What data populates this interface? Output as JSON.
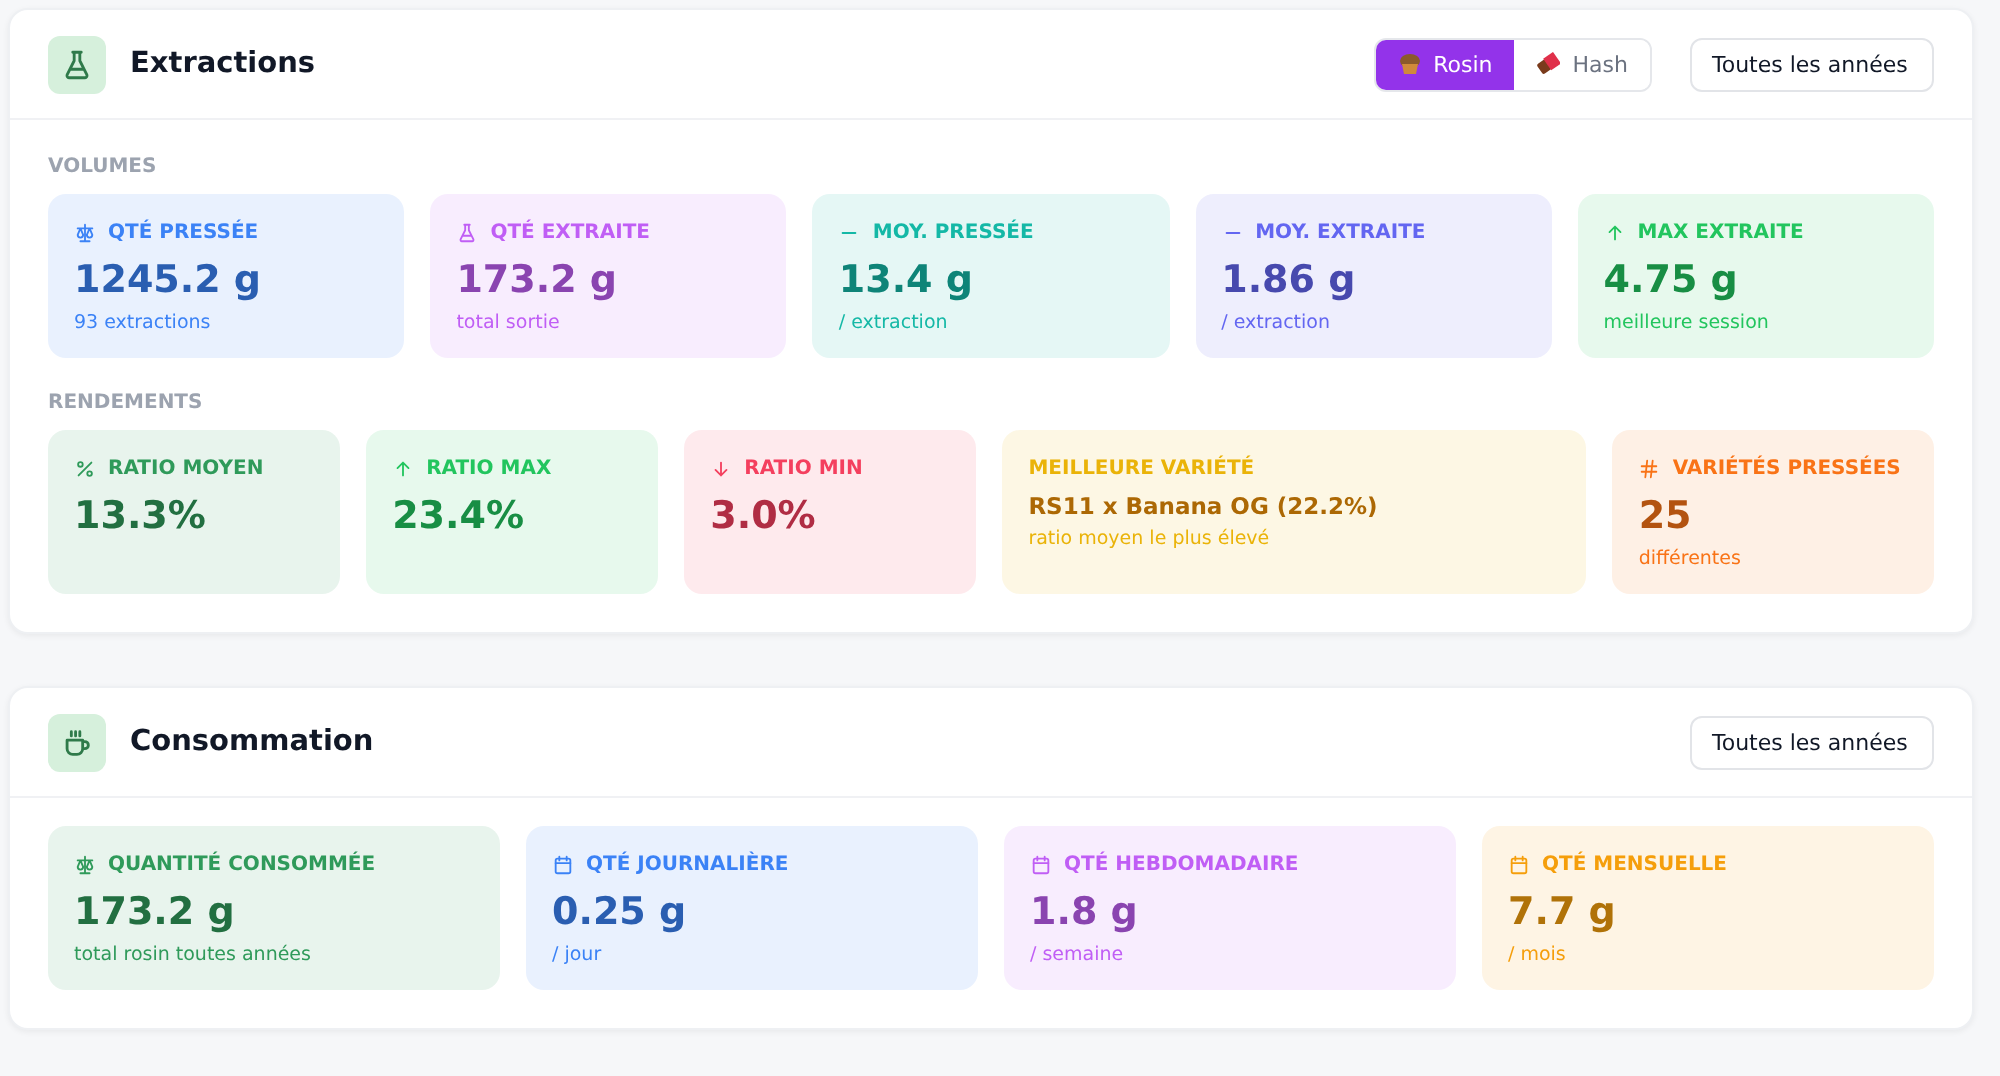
{
  "sections": [
    {
      "title": "Extractions",
      "toggle": [
        {
          "label": "Rosin",
          "selected": true
        },
        {
          "label": "Hash",
          "selected": false
        }
      ],
      "select": {
        "value": "Toutes les années"
      },
      "groups": [
        {
          "heading": "VOLUMES",
          "cards": [
            {
              "kind": "stat",
              "color": "#3b82f6",
              "label": "QTÉ PRESSÉE",
              "value": "1245.2 g",
              "sub": "93 extractions"
            },
            {
              "kind": "stat",
              "color": "#c05ef5",
              "label": "QTÉ EXTRAITE",
              "value": "173.2 g",
              "sub": "total sortie"
            },
            {
              "kind": "stat",
              "color": "#14b8a6",
              "label": "MOY. PRESSÉE",
              "value": "13.4 g",
              "sub": "/ extraction"
            },
            {
              "kind": "stat",
              "color": "#6366f1",
              "label": "MOY. EXTRAITE",
              "value": "1.86 g",
              "sub": "/ extraction"
            },
            {
              "kind": "stat",
              "color": "#22c55e",
              "label": "MAX EXTRAITE",
              "value": "4.75 g",
              "sub": "meilleure session"
            }
          ]
        },
        {
          "heading": "RENDEMENTS",
          "cards": [
            {
              "kind": "stat",
              "color": "#2f9a5a",
              "label": "RATIO MOYEN",
              "value": "13.3%"
            },
            {
              "kind": "stat",
              "color": "#22c55e",
              "label": "RATIO MAX",
              "value": "23.4%"
            },
            {
              "kind": "stat",
              "color": "#f43f5e",
              "label": "RATIO MIN",
              "value": "3.0%"
            },
            {
              "kind": "highlight",
              "color": "#eab308",
              "label": "MEILLEURE VARIÉTÉ",
              "value": "RS11 x Banana OG (22.2%)",
              "sub": "ratio moyen le plus élevé"
            },
            {
              "kind": "stat",
              "color": "#f97316",
              "label": "VARIÉTÉS PRESSÉES",
              "value": "25",
              "sub": "différentes"
            }
          ]
        }
      ]
    },
    {
      "title": "Consommation",
      "select": {
        "value": "Toutes les années"
      },
      "groups": [
        {
          "cards": [
            {
              "kind": "stat",
              "color": "#2f9a5a",
              "label": "QUANTITÉ CONSOMMÉE",
              "value": "173.2 g",
              "sub": "total rosin toutes années"
            },
            {
              "kind": "stat",
              "color": "#3b82f6",
              "label": "QTÉ JOURNALIÈRE",
              "value": "0.25 g",
              "sub": "/ jour"
            },
            {
              "kind": "stat",
              "color": "#c05ef5",
              "label": "QTÉ HEBDOMADAIRE",
              "value": "1.8 g",
              "sub": "/ semaine"
            },
            {
              "kind": "stat",
              "color": "#f59e0b",
              "label": "QTÉ MENSUELLE",
              "value": "7.7 g",
              "sub": "/ mois"
            }
          ]
        }
      ]
    }
  ]
}
